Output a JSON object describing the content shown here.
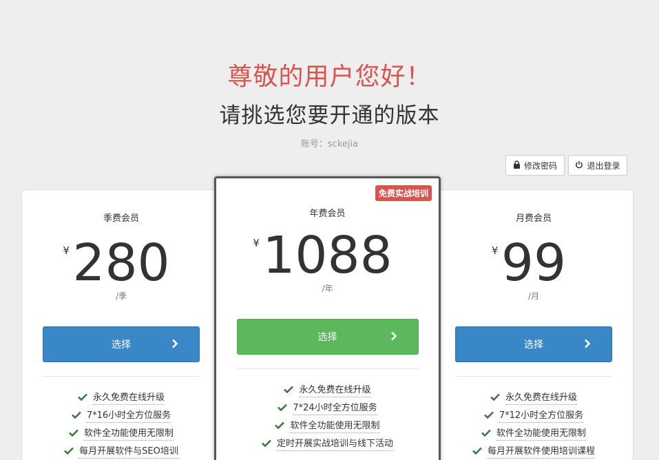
{
  "header": {
    "greeting": "尊敬的用户您好！",
    "subtitle": "请挑选您要开通的版本",
    "account_label": "账号：sckejia"
  },
  "actions": {
    "change_password": "修改密码",
    "logout": "退出登录"
  },
  "plans": [
    {
      "name": "季费会员",
      "currency": "¥",
      "price": "280",
      "period": "/季",
      "select_label": "选择",
      "features": [
        "永久免费在线升级",
        "7*16小时全方位服务",
        "软件全功能使用无限制",
        "每月开展软件与SEO培训"
      ]
    },
    {
      "name": "年费会员",
      "badge": "免费实战培训",
      "currency": "¥",
      "price": "1088",
      "period": "/年",
      "select_label": "选择",
      "features": [
        "永久免费在线升级",
        "7*24小时全方位服务",
        "软件全功能使用无限制",
        "定时开展实战培训与线下活动"
      ]
    },
    {
      "name": "月费会员",
      "currency": "¥",
      "price": "99",
      "period": "/月",
      "select_label": "选择",
      "features": [
        "永久免费在线升级",
        "7*12小时全方位服务",
        "软件全功能使用无限制",
        "每月开展软件使用培训课程"
      ]
    }
  ],
  "colors": {
    "greeting": "#d9534f",
    "primary_button": "#3a87c8",
    "featured_button": "#5cb85c",
    "badge": "#d9534f",
    "check": "#3c763d"
  },
  "icons": {
    "change_password": "lock-icon",
    "logout": "power-icon",
    "select": "chevron-right-icon",
    "feature": "check-icon"
  }
}
